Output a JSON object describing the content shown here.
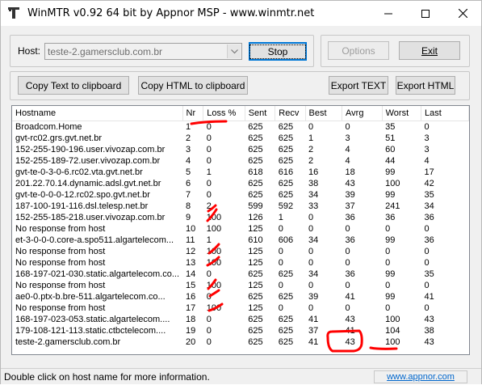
{
  "window": {
    "title": "WinMTR v0.92 64 bit by Appnor MSP - www.winmtr.net"
  },
  "host": {
    "label": "Host:",
    "value": "teste-2.gamersclub.com.br"
  },
  "buttons": {
    "stop": "Stop",
    "options": "Options",
    "exit": "Exit",
    "copy_text": "Copy Text to clipboard",
    "copy_html": "Copy HTML to clipboard",
    "export_text": "Export TEXT",
    "export_html": "Export HTML"
  },
  "table": {
    "columns": [
      "Hostname",
      "Nr",
      "Loss %",
      "Sent",
      "Recv",
      "Best",
      "Avrg",
      "Worst",
      "Last"
    ],
    "rows": [
      [
        "Broadcom.Home",
        "1",
        "0",
        "625",
        "625",
        "0",
        "0",
        "35",
        "0"
      ],
      [
        "gvt-rc02.grs.gvt.net.br",
        "2",
        "0",
        "625",
        "625",
        "1",
        "3",
        "51",
        "3"
      ],
      [
        "152-255-190-196.user.vivozap.com.br",
        "3",
        "0",
        "625",
        "625",
        "2",
        "4",
        "60",
        "3"
      ],
      [
        "152-255-189-72.user.vivozap.com.br",
        "4",
        "0",
        "625",
        "625",
        "2",
        "4",
        "44",
        "4"
      ],
      [
        "gvt-te-0-3-0-6.rc02.vta.gvt.net.br",
        "5",
        "1",
        "618",
        "616",
        "16",
        "18",
        "99",
        "17"
      ],
      [
        "201.22.70.14.dynamic.adsl.gvt.net.br",
        "6",
        "0",
        "625",
        "625",
        "38",
        "43",
        "100",
        "42"
      ],
      [
        "gvt-te-0-0-0-12.rc02.spo.gvt.net.br",
        "7",
        "0",
        "625",
        "625",
        "34",
        "39",
        "99",
        "35"
      ],
      [
        "187-100-191-116.dsl.telesp.net.br",
        "8",
        "2",
        "599",
        "592",
        "33",
        "37",
        "241",
        "34"
      ],
      [
        "152-255-185-218.user.vivozap.com.br",
        "9",
        "100",
        "126",
        "1",
        "0",
        "36",
        "36",
        "36"
      ],
      [
        "No response from host",
        "10",
        "100",
        "125",
        "0",
        "0",
        "0",
        "0",
        "0"
      ],
      [
        "et-3-0-0-0.core-a.spo511.algartelecom...",
        "11",
        "1",
        "610",
        "606",
        "34",
        "36",
        "99",
        "36"
      ],
      [
        "No response from host",
        "12",
        "100",
        "125",
        "0",
        "0",
        "0",
        "0",
        "0"
      ],
      [
        "No response from host",
        "13",
        "100",
        "125",
        "0",
        "0",
        "0",
        "0",
        "0"
      ],
      [
        "168-197-021-030.static.algartelecom.co...",
        "14",
        "0",
        "625",
        "625",
        "34",
        "36",
        "99",
        "35"
      ],
      [
        "No response from host",
        "15",
        "100",
        "125",
        "0",
        "0",
        "0",
        "0",
        "0"
      ],
      [
        "ae0-0.ptx-b.bre-511.algartelecom.co...",
        "16",
        "0",
        "625",
        "625",
        "39",
        "41",
        "99",
        "41"
      ],
      [
        "No response from host",
        "17",
        "100",
        "125",
        "0",
        "0",
        "0",
        "0",
        "0"
      ],
      [
        "168-197-023-053.static.algartelecom....",
        "18",
        "0",
        "625",
        "625",
        "41",
        "43",
        "100",
        "43"
      ],
      [
        "179-108-121-113.static.ctbctelecom....",
        "19",
        "0",
        "625",
        "625",
        "37",
        "41",
        "104",
        "38"
      ],
      [
        "teste-2.gamersclub.com.br",
        "20",
        "0",
        "625",
        "625",
        "41",
        "43",
        "100",
        "43"
      ]
    ]
  },
  "status": {
    "text": "Double click on host name for more information.",
    "link": "www.appnor.com"
  },
  "colors": {
    "annotation": "#ff0000",
    "link": "#0066cc",
    "focus": "#0078d7"
  }
}
